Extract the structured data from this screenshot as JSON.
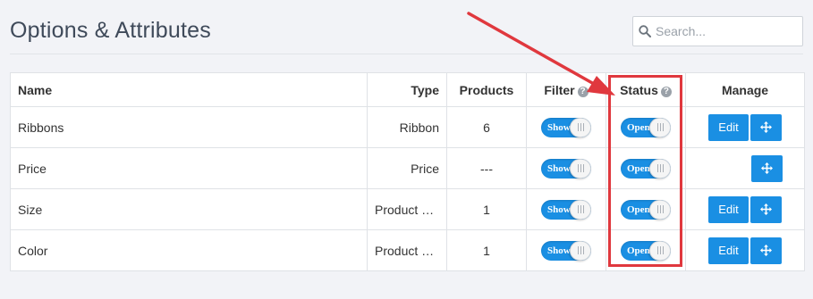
{
  "header": {
    "title": "Options & Attributes",
    "search_placeholder": "Search..."
  },
  "table": {
    "columns": {
      "name": "Name",
      "type": "Type",
      "products": "Products",
      "filter": "Filter",
      "status": "Status",
      "manage": "Manage"
    },
    "help_glyph": "?",
    "rows": [
      {
        "name": "Ribbons",
        "type": "Ribbon",
        "products": "6",
        "filter": "Show",
        "status": "Open",
        "edit": "Edit"
      },
      {
        "name": "Price",
        "type": "Price",
        "products": "---",
        "filter": "Show",
        "status": "Open",
        "edit": null
      },
      {
        "name": "Size",
        "type": "Product O...",
        "products": "1",
        "filter": "Show",
        "status": "Open",
        "edit": "Edit"
      },
      {
        "name": "Color",
        "type": "Product O...",
        "products": "1",
        "filter": "Show",
        "status": "Open",
        "edit": "Edit"
      }
    ]
  },
  "colors": {
    "accent": "#1a8fe3",
    "annotation": "#e0383e",
    "background": "#f2f3f7"
  },
  "icons": {
    "search": "search-icon",
    "help": "help-icon",
    "move": "move-arrows-icon"
  }
}
